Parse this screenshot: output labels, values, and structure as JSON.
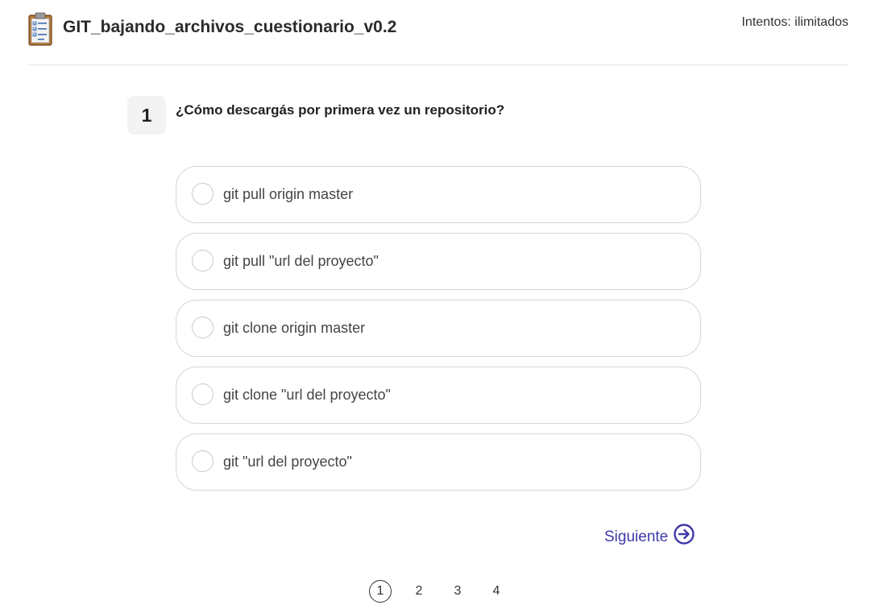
{
  "header": {
    "quiz_title": "GIT_bajando_archivos_cuestionario_v0.2",
    "attempts": "Intentos: ilimitados",
    "icon": "clipboard-checklist-icon"
  },
  "question": {
    "number": "1",
    "text": "¿Cómo descargás por primera vez un repositorio?"
  },
  "options": [
    {
      "label": "git pull origin master"
    },
    {
      "label": "git pull \"url del proyecto\""
    },
    {
      "label": "git clone origin master"
    },
    {
      "label": "git clone \"url del proyecto\""
    },
    {
      "label": "git \"url del proyecto\""
    }
  ],
  "navigation": {
    "next_label": "Siguiente",
    "next_icon": "arrow-right-circle-icon"
  },
  "pagination": {
    "pages": [
      "1",
      "2",
      "3",
      "4"
    ],
    "current": "1"
  },
  "colors": {
    "accent": "#3f3aa8",
    "option_border": "#d6d6d6",
    "number_bg": "#f3f3f3"
  }
}
